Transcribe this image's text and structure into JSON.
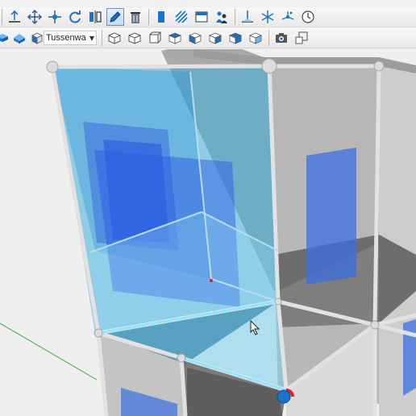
{
  "toolbar_top": {
    "tools": [
      {
        "icon": "push-pull-icon",
        "label": ""
      },
      {
        "icon": "move-icon",
        "label": ""
      },
      {
        "icon": "move-axis-icon",
        "label": ""
      },
      {
        "icon": "rotate-icon",
        "label": ""
      },
      {
        "icon": "flip-icon",
        "label": ""
      },
      {
        "icon": "edit-pen-icon",
        "label": "",
        "active": true
      },
      {
        "icon": "delete-icon",
        "label": ""
      },
      {
        "icon": "wall-icon",
        "label": ""
      },
      {
        "icon": "hatch-icon",
        "label": ""
      },
      {
        "icon": "window-icon",
        "label": ""
      },
      {
        "icon": "people-icon",
        "label": ""
      },
      {
        "icon": "section-icon",
        "label": ""
      },
      {
        "icon": "snowflake-icon",
        "label": ""
      },
      {
        "icon": "axes-icon",
        "label": ""
      },
      {
        "icon": "clock-icon",
        "label": ""
      }
    ]
  },
  "toolbar_bottom": {
    "material_selector": {
      "value": "Tussenwa"
    },
    "view_icons": [
      "iso-view-icon",
      "top-view-icon",
      "front-view-icon",
      "right-view-icon",
      "back-view-icon",
      "left-view-icon",
      "bottom-view-icon",
      "camera-icon",
      "zoom-extents-icon"
    ]
  },
  "colors": {
    "accent": "#1a73c8",
    "glass_selected": "#3fb1e0",
    "panel_blue": "#3a6fe0",
    "frame_gray": "#e2e2e2",
    "background": "#f0f0f0"
  }
}
